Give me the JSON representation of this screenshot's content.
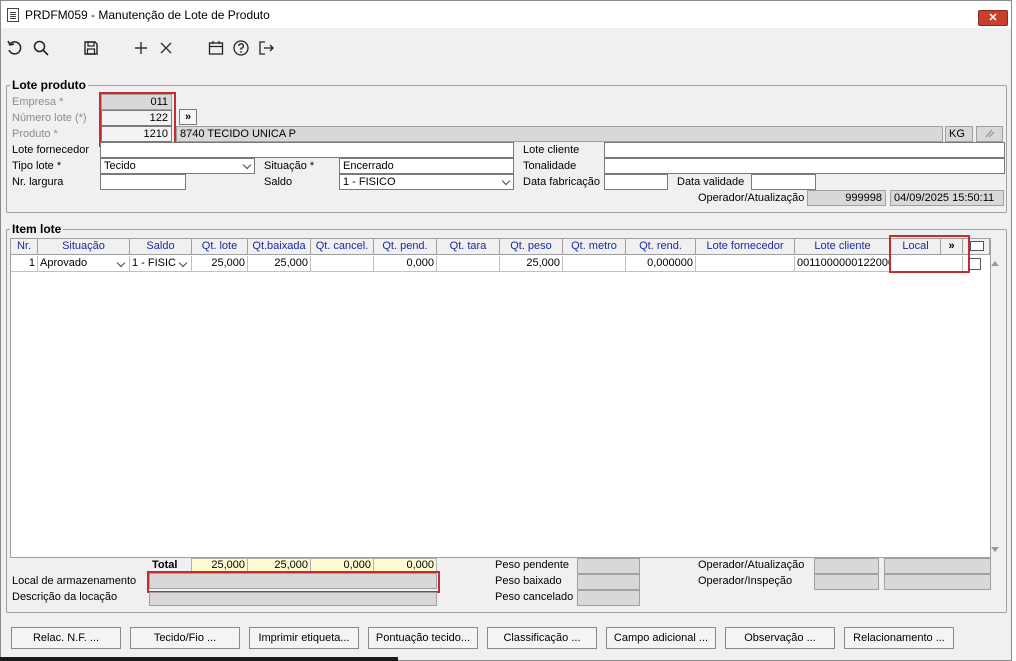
{
  "window": {
    "title": "PRDFM059 - Manutenção de Lote de Produto",
    "close_label": "✕"
  },
  "toolbar": {
    "icons": [
      "undo-icon",
      "search-icon",
      "save-icon",
      "add-icon",
      "delete-icon",
      "calendar-icon",
      "help-icon",
      "exit-icon"
    ]
  },
  "lote": {
    "group_title": "Lote produto",
    "empresa_label": "Empresa *",
    "empresa_value": "011",
    "numero_label": "Número lote (*)",
    "numero_value": "122",
    "produto_label": "Produto *",
    "produto_value": "1210",
    "produto_desc": "8740 TECIDO UNICA P",
    "unidade": "KG",
    "expand_label": "»",
    "lote_fornecedor_label": "Lote fornecedor",
    "lote_fornecedor_value": "",
    "lote_cliente_label": "Lote cliente",
    "lote_cliente_value": "",
    "tipo_lote_label": "Tipo lote *",
    "tipo_lote_value": "Tecido",
    "situacao_label": "Situação *",
    "situacao_value": "Encerrado",
    "tonalidade_label": "Tonalidade",
    "tonalidade_value": "",
    "nr_largura_label": "Nr. largura",
    "nr_largura_value": "",
    "saldo_label": "Saldo",
    "saldo_value": "1 - FISICO",
    "data_fabricacao_label": "Data fabricação",
    "data_fabricacao_value": "",
    "data_validade_label": "Data validade",
    "data_validade_value": "",
    "operador_label": "Operador/Atualização",
    "operador_value": "999998",
    "atualizacao_value": "04/09/2025 15:50:11"
  },
  "item": {
    "group_title": "Item lote",
    "columns": [
      "Nr.",
      "Situação",
      "Saldo",
      "Qt. lote",
      "Qt.baixada",
      "Qt. cancel.",
      "Qt. pend.",
      "Qt. tara",
      "Qt. peso",
      "Qt. metro",
      "Qt. rend.",
      "Lote fornecedor",
      "Lote cliente",
      "Local"
    ],
    "expand_label": "»",
    "rows": [
      {
        "nr": "1",
        "situacao": "Aprovado",
        "saldo": "1 - FISIC",
        "qt_lote": "25,000",
        "qt_baixada": "25,000",
        "qt_cancel": "",
        "qt_pend": "0,000",
        "qt_tara": "",
        "qt_peso": "25,000",
        "qt_metro": "",
        "qt_rend": "0,000000",
        "lote_fornecedor": "",
        "lote_cliente": "0011000000122000",
        "local": ""
      }
    ],
    "total_label": "Total",
    "totals": [
      "25,000",
      "25,000",
      "0,000",
      "0,000"
    ],
    "local_armazenamento_label": "Local de armazenamento",
    "local_armazenamento_value": "",
    "descricao_locacao_label": "Descrição da locação",
    "descricao_locacao_value": "",
    "peso_pendente_label": "Peso pendente",
    "peso_pendente_value": "",
    "peso_baixado_label": "Peso baixado",
    "peso_baixado_value": "",
    "peso_cancelado_label": "Peso cancelado",
    "peso_cancelado_value": "",
    "operador_atualizacao_label": "Operador/Atualização",
    "operador_inspecao_label": "Operador/Inspeção"
  },
  "buttons": [
    "Relac. N.F. ...",
    "Tecido/Fio ...",
    "Imprimir etiqueta...",
    "Pontuação tecido...",
    "Classificação ...",
    "Campo adicional ...",
    "Observação ...",
    "Relacionamento ..."
  ]
}
